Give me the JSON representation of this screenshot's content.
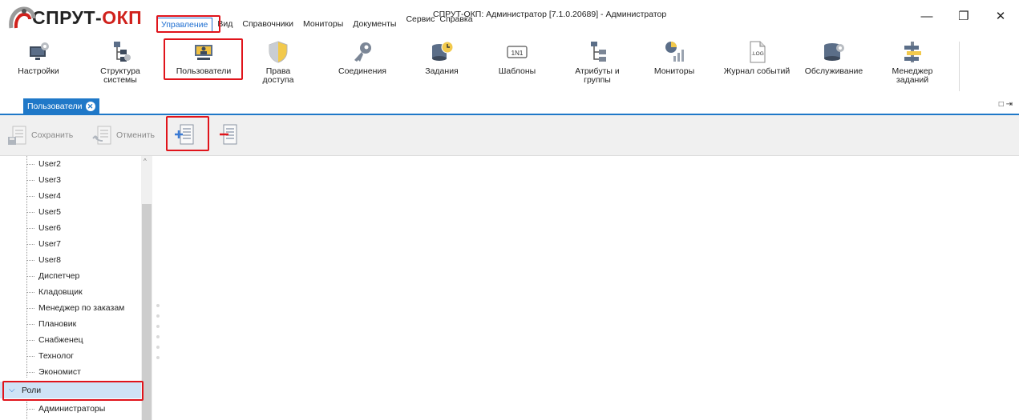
{
  "app": {
    "logo_text_main": "СПРУТ-",
    "logo_text_accent": "ОКП",
    "window_title": "СПРУТ-ОКП: Администратор [7.1.0.20689] - Администратор"
  },
  "window_controls": {
    "minimize": "—",
    "restore": "❐",
    "close": "✕"
  },
  "menu": {
    "items": [
      {
        "label": "Управление",
        "active": true
      },
      {
        "label": "Вид",
        "active": false
      },
      {
        "label": "Справочники",
        "active": false
      },
      {
        "label": "Мониторы",
        "active": false
      },
      {
        "label": "Документы",
        "active": false
      },
      {
        "label": "Сервис",
        "active": false
      },
      {
        "label": "Справка",
        "active": false
      }
    ]
  },
  "ribbon": {
    "items": [
      {
        "label": "Настройки",
        "icon": "settings-monitor-icon"
      },
      {
        "label": "Структура системы",
        "icon": "structure-tree-icon"
      },
      {
        "label": "Пользователи",
        "icon": "users-presentation-icon"
      },
      {
        "label": "Права доступа",
        "icon": "shield-icon"
      },
      {
        "label": "Соединения",
        "icon": "key-icon"
      },
      {
        "label": "Задания",
        "icon": "database-clock-icon"
      },
      {
        "label": "Шаблоны",
        "icon": "template-1n1-icon"
      },
      {
        "label": "Атрибуты и группы",
        "icon": "attributes-tree-icon"
      },
      {
        "label": "Мониторы",
        "icon": "chart-monitor-icon"
      },
      {
        "label": "Журнал событий",
        "icon": "log-file-icon"
      },
      {
        "label": "Обслуживание",
        "icon": "database-gear-icon"
      },
      {
        "label": "Менеджер заданий",
        "icon": "task-manager-icon"
      }
    ]
  },
  "tabs": {
    "active": "Пользователи",
    "close_symbol": "✕",
    "pin_symbol": "□ ⇥"
  },
  "toolbar": {
    "save_label": "Сохранить",
    "cancel_label": "Отменить",
    "add_icon": "add-record-icon",
    "remove_icon": "remove-record-icon"
  },
  "tree": {
    "users": [
      "User2",
      "User3",
      "User4",
      "User5",
      "User6",
      "User7",
      "User8",
      "Диспетчер",
      "Кладовщик",
      "Менеджер по заказам",
      "Плановик",
      "Снабженец",
      "Технолог",
      "Экономист"
    ],
    "roles_label": "Роли",
    "roles": [
      "Администраторы"
    ],
    "scroll_up_symbol": "^"
  },
  "colors": {
    "accent_blue": "#1f78c8",
    "highlight_red": "#e0141b",
    "selection": "#cfe3f6"
  }
}
